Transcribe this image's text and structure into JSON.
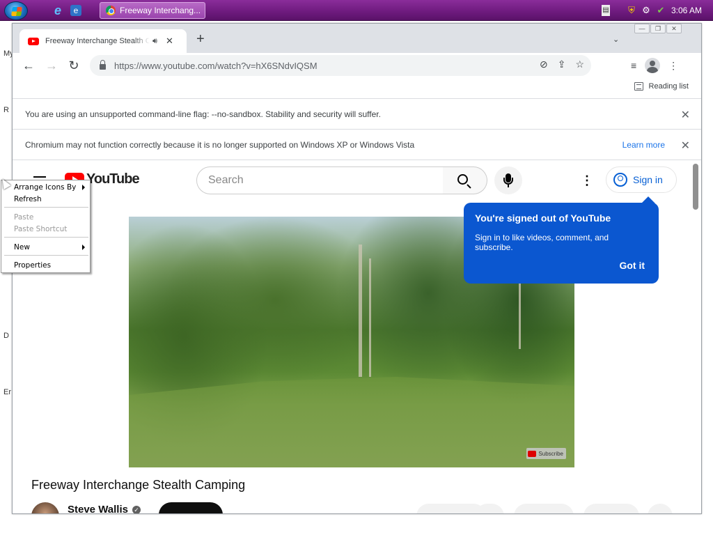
{
  "taskbar": {
    "task_button_label": "Freeway Interchang...",
    "clock": "3:06 AM"
  },
  "desktop": {
    "icon_labels": [
      "My",
      "R",
      "D",
      "Er"
    ]
  },
  "browser": {
    "tab": {
      "title": "Freeway Interchange Stealth Camping",
      "close": "✕"
    },
    "new_tab": "+",
    "tab_search": "⌄",
    "window_controls": [
      "—",
      "❐",
      "✕"
    ],
    "url": "https://www.youtube.com/watch?v=hX6SNdvIQSM",
    "reading_list": "Reading list"
  },
  "infobars": [
    {
      "text": "You are using an unsupported command-line flag: --no-sandbox. Stability and security will suffer."
    },
    {
      "text": "Chromium may not function correctly because it is no longer supported on Windows XP or Windows Vista",
      "link": "Learn more"
    }
  ],
  "youtube": {
    "logo_text": "YouTube",
    "search_placeholder": "Search",
    "signin_label": "Sign in",
    "popup": {
      "title": "You're signed out of YouTube",
      "body": "Sign in to like videos, comment, and subscribe.",
      "button": "Got it"
    },
    "video_watermark": "Subscribe",
    "video_title": "Freeway Interchange Stealth Camping",
    "channel_name": "Steve Wallis"
  },
  "context_menu": {
    "items": [
      {
        "label": "Arrange Icons By",
        "enabled": true,
        "submenu": true
      },
      {
        "label": "Refresh",
        "enabled": true
      },
      {
        "label": "Paste",
        "enabled": false
      },
      {
        "label": "Paste Shortcut",
        "enabled": false
      },
      {
        "label": "New",
        "enabled": true,
        "submenu": true
      },
      {
        "label": "Properties",
        "enabled": true
      }
    ]
  },
  "colors": {
    "taskbar": "#6d1a7d",
    "youtube_red": "#ff0000",
    "popup_blue": "#0b57d0",
    "link_blue": "#1a73e8"
  }
}
